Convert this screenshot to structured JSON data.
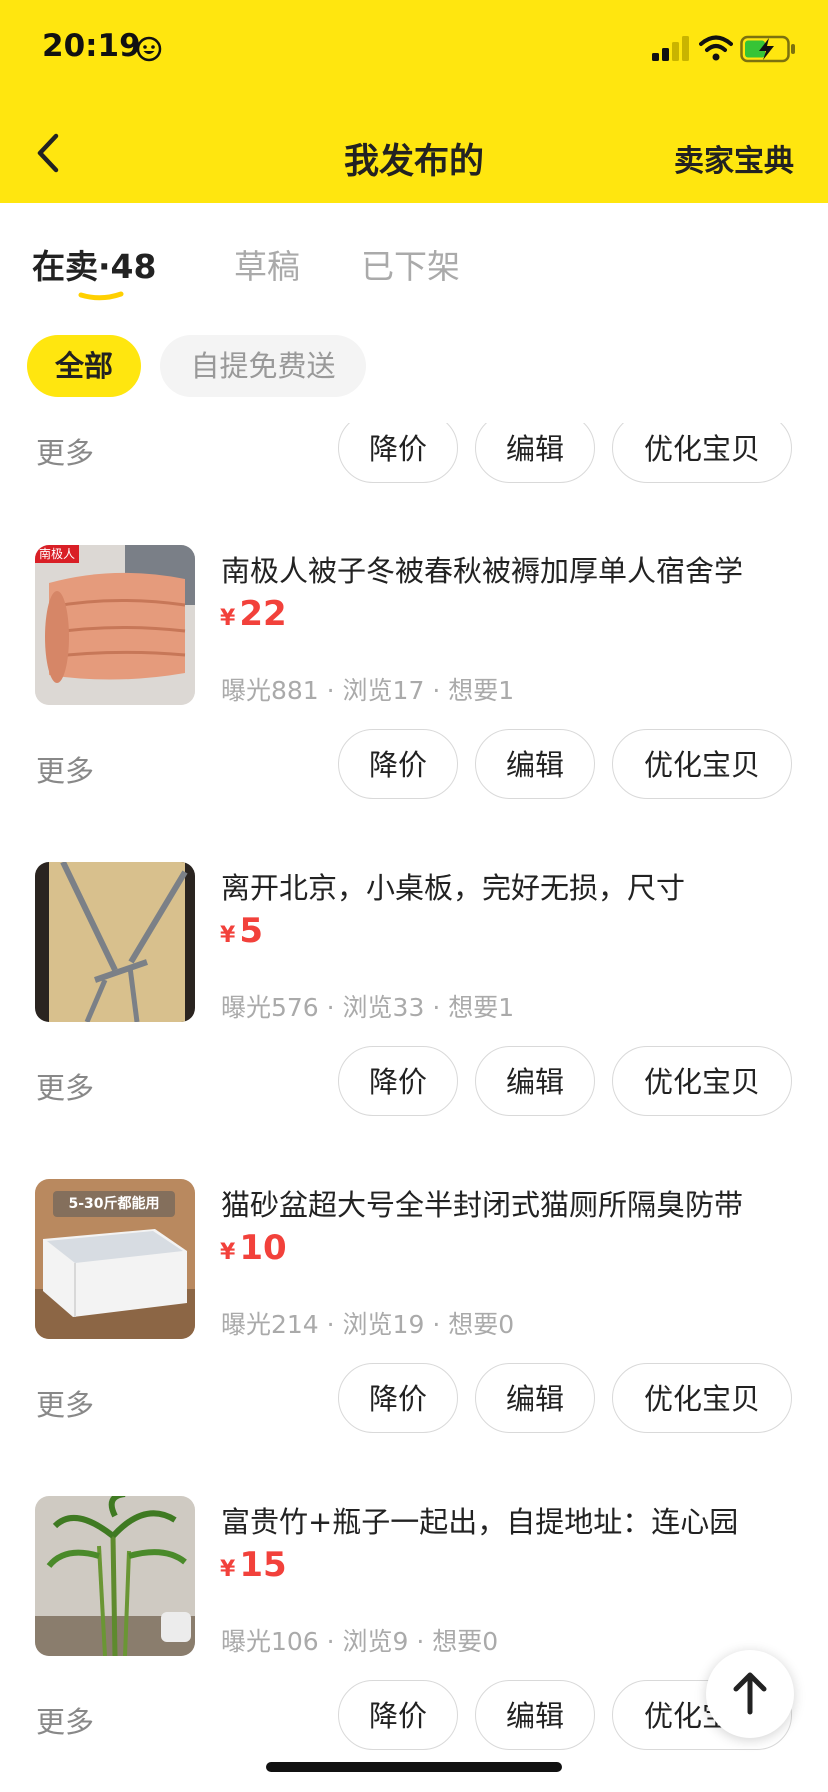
{
  "status_bar": {
    "time": "20:19"
  },
  "header": {
    "title": "我发布的",
    "right_link": "卖家宝典"
  },
  "tabs": [
    {
      "label": "在卖·48"
    },
    {
      "label": "草稿"
    },
    {
      "label": "已下架"
    }
  ],
  "filters": [
    {
      "label": "全部"
    },
    {
      "label": "自提免费送"
    }
  ],
  "row_actions": {
    "more": "更多",
    "reduce_price": "降价",
    "edit": "编辑",
    "optimize": "优化宝贝"
  },
  "items": [
    {
      "title": "南极人被子冬被春秋被褥加厚单人宿舍学",
      "currency": "¥",
      "price": "22",
      "stats": "曝光881 · 浏览17 · 想要1",
      "thumb_tag": "南极人"
    },
    {
      "title": "离开北京，小桌板，完好无损，尺寸",
      "currency": "¥",
      "price": "5",
      "stats": "曝光576 · 浏览33 · 想要1"
    },
    {
      "title": "猫砂盆超大号全半封闭式猫厕所隔臭防带",
      "currency": "¥",
      "price": "10",
      "stats": "曝光214 · 浏览19 · 想要0",
      "thumb_tag": "5-30斤都能用"
    },
    {
      "title": "富贵竹+瓶子一起出，自提地址：连心园",
      "currency": "¥",
      "price": "15",
      "stats": "曝光106 · 浏览9 · 想要0"
    }
  ],
  "colors": {
    "brand_yellow": "#ffe60f",
    "price_red": "#f2413b"
  }
}
